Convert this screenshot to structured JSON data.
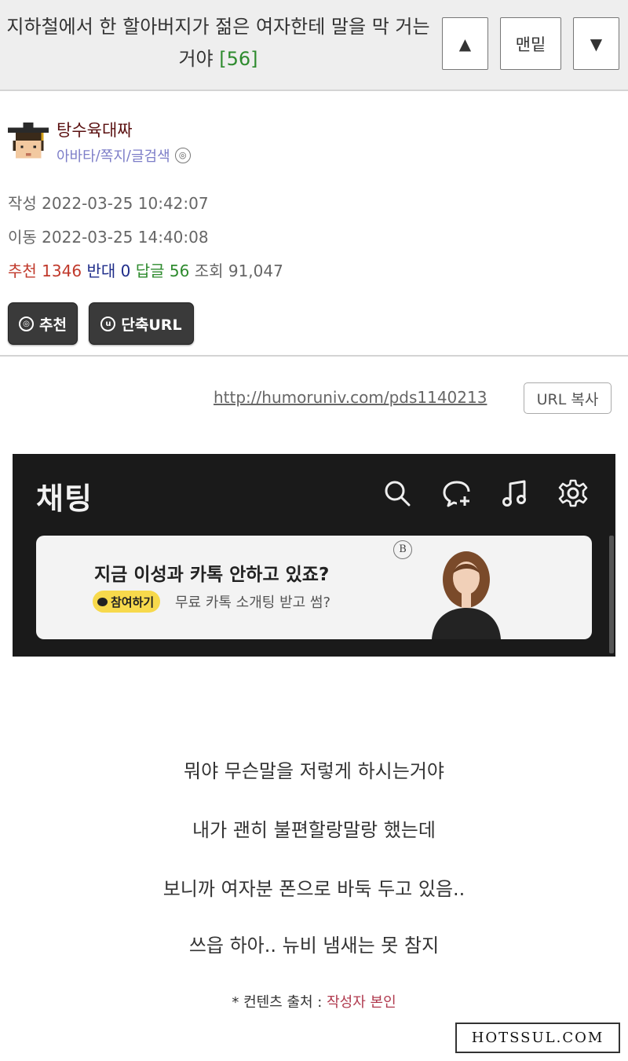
{
  "header": {
    "title": "지하철에서 한 할아버지가 젊은 여자한테 말을 막 거는거야",
    "reply_count": "[56]",
    "up_label": "▲",
    "bottom_label": "맨밑",
    "down_label": "▼"
  },
  "author": {
    "nickname": "탕수육대짜",
    "link_avatar": "아바타",
    "link_message": "쪽지",
    "link_search": "글검색",
    "sep": "/"
  },
  "meta": {
    "written_label": "작성",
    "written_value": "2022-03-25 10:42:07",
    "moved_label": "이동",
    "moved_value": "2022-03-25 14:40:08",
    "recommend_label": "추천",
    "recommend_value": "1346",
    "oppose_label": "반대",
    "oppose_value": "0",
    "reply_label": "답글",
    "reply_value": "56",
    "views_label": "조회",
    "views_value": "91,047"
  },
  "actions": {
    "recommend_button": "추천",
    "short_url_button": "단축URL"
  },
  "share": {
    "url": "http://humoruniv.com/pds1140213",
    "copy_label": "URL 복사"
  },
  "embedded_screenshot": {
    "title": "채팅",
    "icons": [
      "search-icon",
      "new-chat-icon",
      "music-icon",
      "settings-icon"
    ],
    "ad_headline": "지금 이성과 카톡 안하고 있죠?",
    "ad_tag": "참여하기",
    "ad_sub": "무료 카톡 소개팅 받고 썸?",
    "ad_logo": "B"
  },
  "body": {
    "line1": "뭐야  무슨말을 저렇게 하시는거야",
    "line2": "내가 괜히 불편할랑말랑 했는데",
    "line3": "보니까 여자분 폰으로 바둑 두고 있음..",
    "line4": "쓰읍 하아.. 뉴비 냄새는 못 참지"
  },
  "source": {
    "prefix": "* 컨텐츠 출처 : ",
    "who": "작성자 본인"
  },
  "watermark": "HOTSSUL.COM",
  "colors": {
    "recommend": "#c0392b",
    "oppose": "#1f2d8a",
    "reply": "#2e8b2e",
    "nickname": "#5a1010",
    "link": "#7d7ec8",
    "ad_tag": "#f7d94c"
  }
}
